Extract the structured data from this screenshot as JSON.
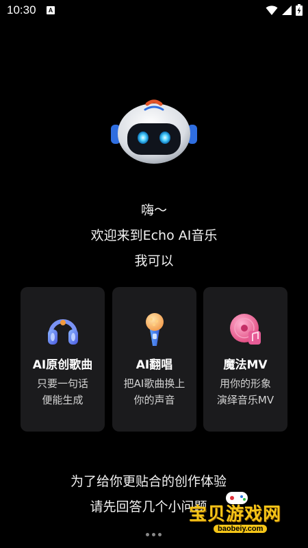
{
  "status_bar": {
    "time": "10:30",
    "notification_badge": "A"
  },
  "intro": {
    "line1": "嗨～",
    "line2": "欢迎来到Echo AI音乐",
    "line3": "我可以"
  },
  "cards": [
    {
      "title": "AI原创歌曲",
      "desc1": "只要一句话",
      "desc2": "便能生成",
      "icon": "headphones-icon"
    },
    {
      "title": "AI翻唱",
      "desc1": "把AI歌曲换上",
      "desc2": "你的声音",
      "icon": "microphone-icon"
    },
    {
      "title": "魔法MV",
      "desc1": "用你的形象",
      "desc2": "演绎音乐MV",
      "icon": "vinyl-record-icon"
    }
  ],
  "outro": {
    "line1": "为了给你更贴合的创作体验",
    "line2": "请先回答几个小问题"
  },
  "watermark": {
    "text": "宝贝游戏网",
    "url": "baobeiy.com"
  }
}
